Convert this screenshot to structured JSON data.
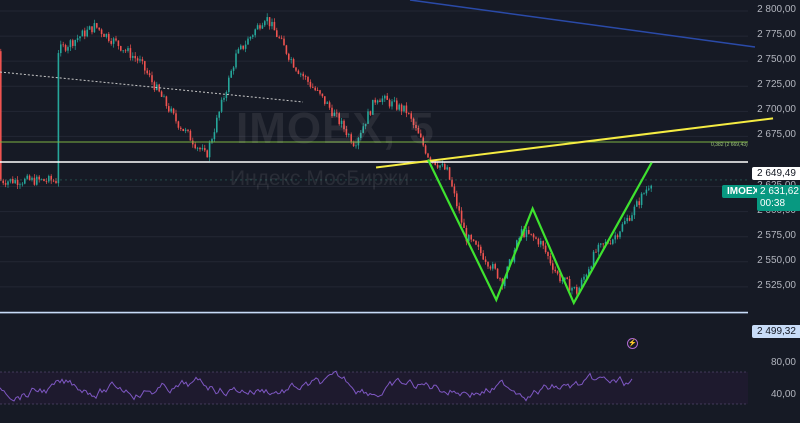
{
  "chart": {
    "watermark_ticker": "IMOEX, 5",
    "watermark_desc": "Индекс МосБиржи",
    "symbol": "IMOEX",
    "last_price": "2 631,62",
    "countdown": "00:38",
    "fib_label": "0,382 (2 669,43)",
    "levels": {
      "resistance_label": "2 649,49",
      "support_label": "2 499,32"
    },
    "y_axis_labels": [
      "2 800,00",
      "2 775,00",
      "2 750,00",
      "2 725,00",
      "2 700,00",
      "2 675,00",
      "2 625,00",
      "2 600,00",
      "2 575,00",
      "2 550,00",
      "2 525,00"
    ],
    "rsi_axis_labels": [
      "80,00",
      "40,00"
    ],
    "colors": {
      "background": "#161a25",
      "up": "#26a69a",
      "down": "#ef5350",
      "resistance": "#ffffff",
      "support": "#c8dcf8",
      "trendline": "#f5ec42",
      "pattern": "#3ee22f",
      "fib": "#7cb342",
      "downtrend": "#2a4aa8",
      "rsi": "#7e57c2"
    },
    "alert_icon": "lightning-icon"
  },
  "chart_data": {
    "type": "candlestick",
    "symbol": "IMOEX",
    "timeframe": "5",
    "y_range": [
      2490,
      2810
    ],
    "last_price": 2631.62,
    "horizontal_levels": [
      {
        "value": 2649.49
      },
      {
        "value": 2499.32
      },
      {
        "value": 2669.43,
        "label": "0,382 (2 669,43)"
      }
    ],
    "pattern_points": [
      {
        "bar": 0.0,
        "price": 2652
      },
      {
        "bar": 0.184,
        "price": 2512
      },
      {
        "bar": 0.282,
        "price": 2603
      },
      {
        "bar": 0.393,
        "price": 2509
      },
      {
        "bar": 0.603,
        "price": 2649
      }
    ],
    "trendline": {
      "from": {
        "bar": -0.14,
        "price": 2644
      },
      "to": {
        "bar": 0.93,
        "price": 2693
      }
    },
    "price_series": [
      {
        "bar": -1.0,
        "price": 2760
      },
      {
        "bar": -0.9,
        "price": 2785
      },
      {
        "bar": -0.78,
        "price": 2750
      },
      {
        "bar": -0.68,
        "price": 2690
      },
      {
        "bar": -0.6,
        "price": 2655
      },
      {
        "bar": -0.52,
        "price": 2755
      },
      {
        "bar": -0.44,
        "price": 2795
      },
      {
        "bar": -0.36,
        "price": 2745
      },
      {
        "bar": -0.27,
        "price": 2705
      },
      {
        "bar": -0.2,
        "price": 2668
      },
      {
        "bar": -0.14,
        "price": 2715
      },
      {
        "bar": -0.06,
        "price": 2700
      },
      {
        "bar": 0.0,
        "price": 2655
      },
      {
        "bar": 0.05,
        "price": 2640
      },
      {
        "bar": 0.1,
        "price": 2575
      },
      {
        "bar": 0.15,
        "price": 2555
      },
      {
        "bar": 0.2,
        "price": 2530
      },
      {
        "bar": 0.25,
        "price": 2580
      },
      {
        "bar": 0.3,
        "price": 2570
      },
      {
        "bar": 0.35,
        "price": 2535
      },
      {
        "bar": 0.4,
        "price": 2520
      },
      {
        "bar": 0.45,
        "price": 2560
      },
      {
        "bar": 0.5,
        "price": 2575
      },
      {
        "bar": 0.55,
        "price": 2600
      },
      {
        "bar": 0.6,
        "price": 2631
      }
    ],
    "rsi": {
      "ticks": [
        80,
        40
      ]
    }
  }
}
